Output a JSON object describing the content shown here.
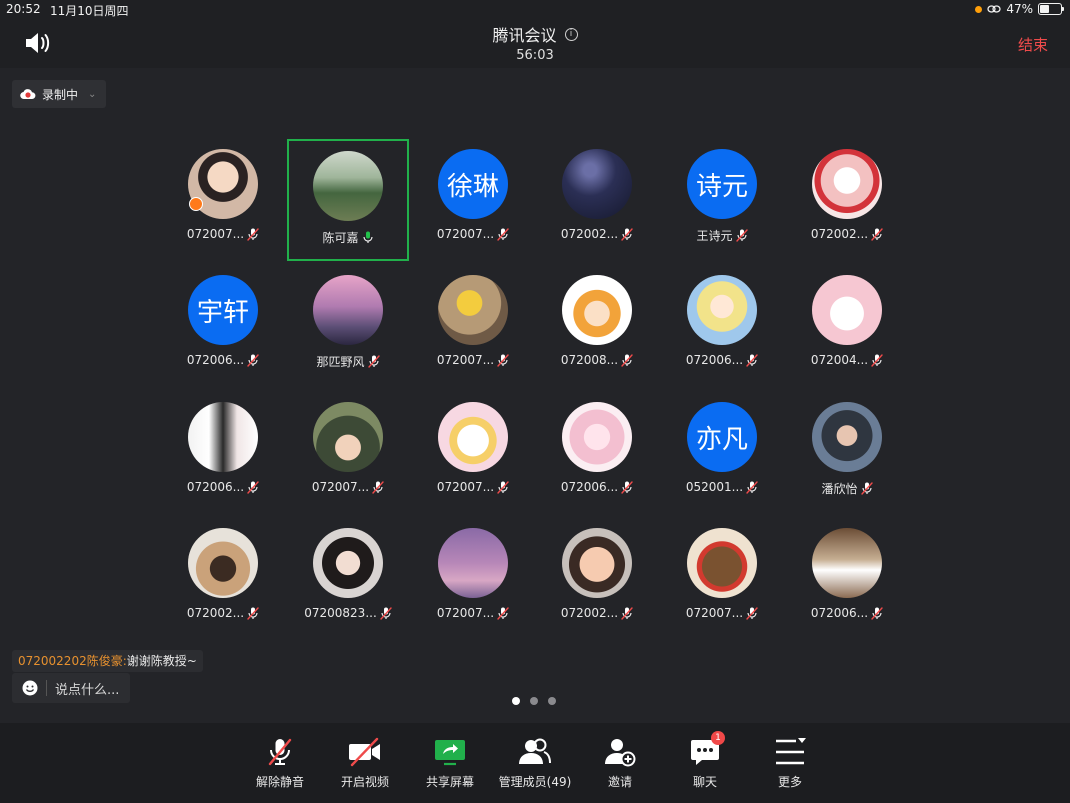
{
  "status_bar": {
    "time": "20:52",
    "date": "11月10日周四",
    "battery": "47%",
    "battery_level": 0.47
  },
  "header": {
    "title": "腾讯会议",
    "info_icon": "info-icon",
    "duration": "56:03",
    "end_label": "结束",
    "end_color": "#ef4b4b"
  },
  "recording": {
    "label": "录制中"
  },
  "participants": [
    {
      "name": "072007...",
      "avatar": "photo-child",
      "muted": true,
      "host": true
    },
    {
      "name": "陈可嘉",
      "avatar": "photo-landscape",
      "muted": false,
      "speaking": true,
      "active": true
    },
    {
      "name": "072007...",
      "avatar_text": "徐琳",
      "muted": true
    },
    {
      "name": "072002...",
      "avatar": "photo-starry-sky",
      "muted": true
    },
    {
      "name": "王诗元",
      "avatar_text": "诗元",
      "muted": true
    },
    {
      "name": "072002...",
      "avatar": "photo-cartoon-flowers",
      "muted": true
    },
    {
      "name": "072006...",
      "avatar_text": "宇轩",
      "muted": true
    },
    {
      "name": "那匹野风",
      "avatar": "photo-pink-sunset",
      "muted": true
    },
    {
      "name": "072007...",
      "avatar": "photo-dog-hat",
      "muted": true
    },
    {
      "name": "072008...",
      "avatar": "photo-cartoon-boy",
      "muted": true
    },
    {
      "name": "072006...",
      "avatar": "photo-anime-girl",
      "muted": true
    },
    {
      "name": "072004...",
      "avatar": "photo-pink-bunny",
      "muted": true
    },
    {
      "name": "072006...",
      "avatar": "photo-girl-portrait",
      "muted": true
    },
    {
      "name": "072007...",
      "avatar": "photo-kid-umbrella",
      "muted": true
    },
    {
      "name": "072007...",
      "avatar": "photo-cartoon-sheep",
      "muted": true
    },
    {
      "name": "072006...",
      "avatar": "photo-anime-pink",
      "muted": true
    },
    {
      "name": "052001...",
      "avatar_text": "亦凡",
      "muted": true
    },
    {
      "name": "潘欣怡",
      "avatar": "photo-girl-hood",
      "muted": true
    },
    {
      "name": "072002...",
      "avatar": "photo-shiba-dog",
      "muted": true
    },
    {
      "name": "07200823...",
      "avatar": "photo-woman-bob",
      "muted": true
    },
    {
      "name": "072007...",
      "avatar": "photo-purple-sky",
      "muted": true
    },
    {
      "name": "072002...",
      "avatar": "photo-smiling-girl",
      "muted": true
    },
    {
      "name": "072007...",
      "avatar": "photo-teddy-bear",
      "muted": true
    },
    {
      "name": "072006...",
      "avatar": "photo-person-street",
      "muted": true
    }
  ],
  "chat": {
    "last_sender": "072002202陈俊豪:",
    "last_message": "谢谢陈教授~",
    "input_placeholder": "说点什么..."
  },
  "pagination": {
    "pages": 3,
    "current": 1
  },
  "toolbar": [
    {
      "label": "解除静音",
      "icon": "mic-off-icon"
    },
    {
      "label": "开启视频",
      "icon": "camera-off-icon"
    },
    {
      "label": "共享屏幕",
      "icon": "share-screen-icon",
      "color": "#21b04b"
    },
    {
      "label": "管理成员(49)",
      "icon": "members-icon"
    },
    {
      "label": "邀请",
      "icon": "invite-icon"
    },
    {
      "label": "聊天",
      "icon": "chat-icon",
      "badge": "1"
    },
    {
      "label": "更多",
      "icon": "more-icon"
    }
  ]
}
